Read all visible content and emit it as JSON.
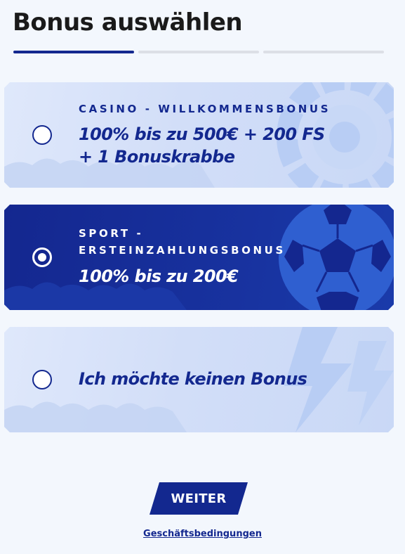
{
  "header": {
    "title": "Bonus auswählen"
  },
  "stepper": {
    "total_steps": 3,
    "current_step": 1
  },
  "options": [
    {
      "id": "casino",
      "category": "CASINO - WILLKOMMENSBONUS",
      "offer_line1": "100% bis zu 500€ + 200 FS",
      "offer_line2": "+ 1 Bonuskrabbe",
      "selected": false,
      "theme": "light"
    },
    {
      "id": "sport",
      "category_line1": "SPORT -",
      "category_line2": "ERSTEINZAHLUNGSBONUS",
      "offer_line1": "100% bis zu 200€",
      "selected": true,
      "theme": "dark"
    },
    {
      "id": "none",
      "offer_line1": "Ich möchte keinen Bonus",
      "selected": false,
      "theme": "light"
    }
  ],
  "actions": {
    "continue_label": "WEITER",
    "terms_label": "Geschäftsbedingungen"
  },
  "colors": {
    "brand": "#13288f",
    "background": "#f3f7fd",
    "card_light": "#d2def8",
    "step_inactive": "#dcdfe6"
  },
  "icons": {
    "casino_card": "roulette-wheel-icon",
    "sport_card": "soccer-ball-icon",
    "none_card": "lightning-bolt-icon"
  }
}
